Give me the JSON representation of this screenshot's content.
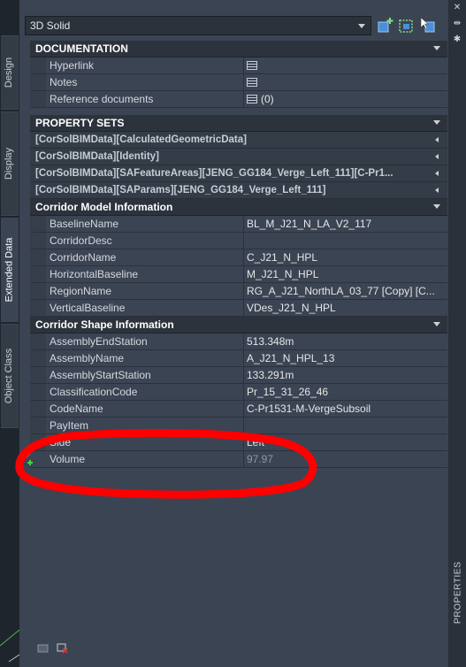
{
  "left_tabs": [
    "Design",
    "Display",
    "Extended Data",
    "Object Class"
  ],
  "object_type": "3D Solid",
  "documentation": {
    "title": "DOCUMENTATION",
    "rows": [
      {
        "name": "Hyperlink",
        "value": ""
      },
      {
        "name": "Notes",
        "value": ""
      },
      {
        "name": "Reference documents",
        "value": "(0)"
      }
    ]
  },
  "property_sets": {
    "title": "PROPERTY SETS",
    "groups": [
      "[CorSolBIMData][CalculatedGeometricData]",
      "[CorSolBIMData][Identity]",
      "[CorSolBIMData][SAFeatureAreas][JENG_GG184_Verge_Left_111][C-Pr1...",
      "[CorSolBIMData][SAParams][JENG_GG184_Verge_Left_111]"
    ]
  },
  "corridor_model": {
    "title": "Corridor Model Information",
    "rows": [
      {
        "name": "BaselineName",
        "value": "BL_M_J21_N_LA_V2_117"
      },
      {
        "name": "CorridorDesc",
        "value": ""
      },
      {
        "name": "CorridorName",
        "value": "C_J21_N_HPL"
      },
      {
        "name": "HorizontalBaseline",
        "value": "M_J21_N_HPL"
      },
      {
        "name": "RegionName",
        "value": "RG_A_J21_NorthLA_03_77 [Copy] [C..."
      },
      {
        "name": "VerticalBaseline",
        "value": "VDes_J21_N_HPL"
      }
    ]
  },
  "corridor_shape": {
    "title": "Corridor Shape Information",
    "rows": [
      {
        "name": "AssemblyEndStation",
        "value": "513.348m"
      },
      {
        "name": "AssemblyName",
        "value": "A_J21_N_HPL_13"
      },
      {
        "name": "AssemblyStartStation",
        "value": "133.291m"
      },
      {
        "name": "ClassificationCode",
        "value": "Pr_15_31_26_46"
      },
      {
        "name": "CodeName",
        "value": "C-Pr1531-M-VergeSubsoil"
      },
      {
        "name": "PayItem",
        "value": ""
      },
      {
        "name": "Side",
        "value": "Left"
      },
      {
        "name": "Volume",
        "value": "97.97"
      }
    ]
  },
  "right_strip_label": "PROPERTIES",
  "colors": {
    "annotation": "#ff0000",
    "panel": "#3b4453"
  }
}
